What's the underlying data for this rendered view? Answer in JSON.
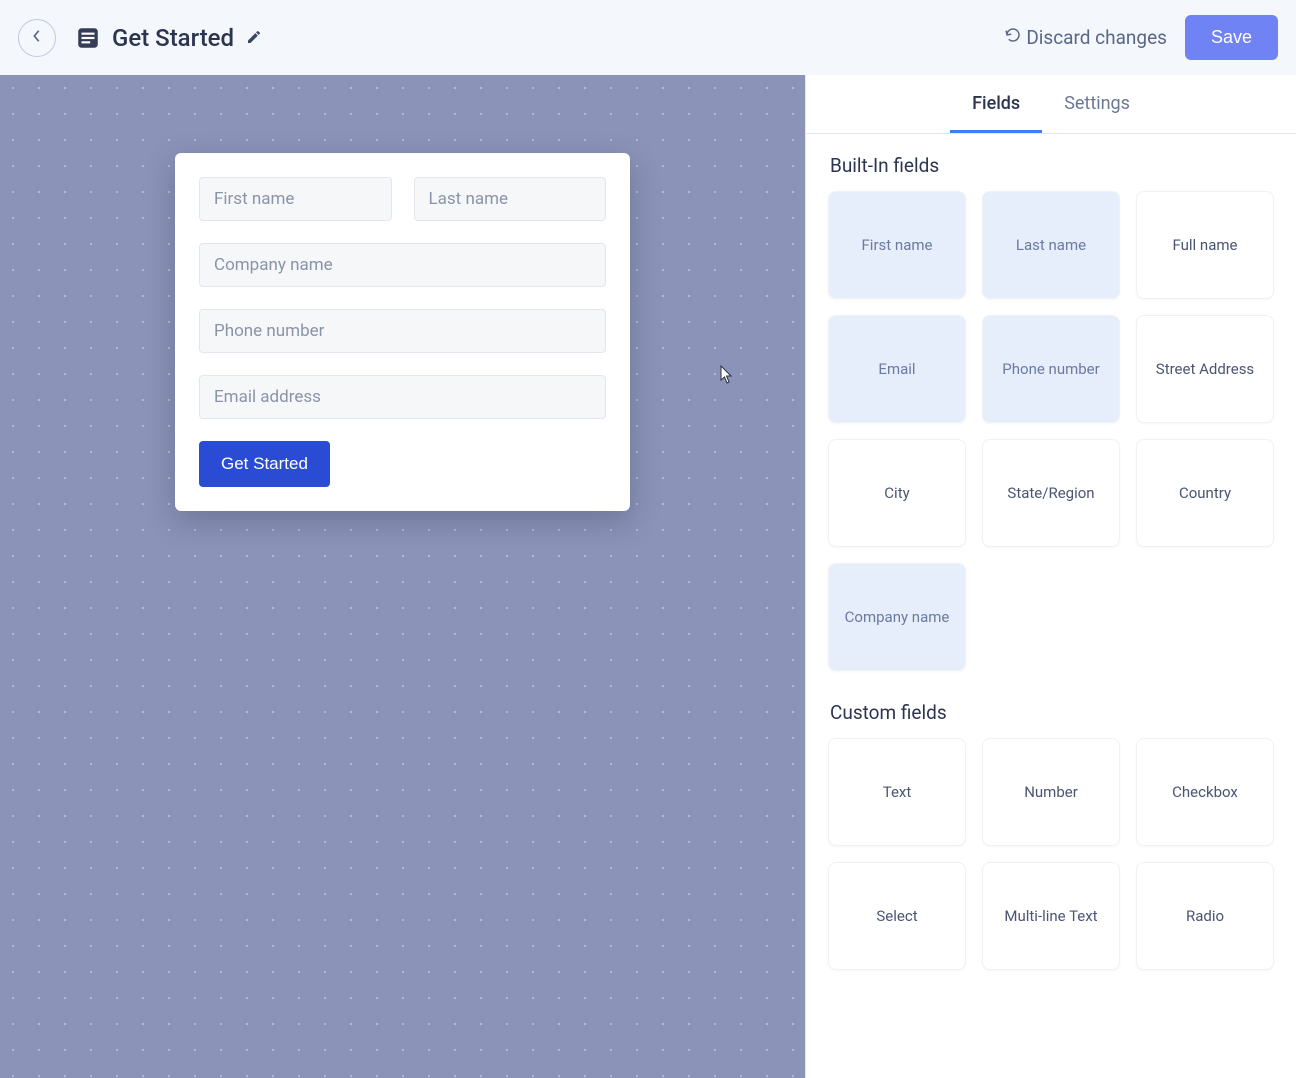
{
  "header": {
    "page_title": "Get Started",
    "discard_label": "Discard changes",
    "save_label": "Save"
  },
  "form": {
    "fields": [
      {
        "placeholder": "First name"
      },
      {
        "placeholder": "Last name"
      },
      {
        "placeholder": "Company name"
      },
      {
        "placeholder": "Phone number"
      },
      {
        "placeholder": "Email address"
      }
    ],
    "submit_label": "Get Started"
  },
  "panel": {
    "tabs": [
      {
        "label": "Fields",
        "active": true
      },
      {
        "label": "Settings",
        "active": false
      }
    ],
    "builtin_title": "Built-In fields",
    "builtin_fields": [
      {
        "label": "First name",
        "used": true
      },
      {
        "label": "Last name",
        "used": true
      },
      {
        "label": "Full name",
        "used": false
      },
      {
        "label": "Email",
        "used": true
      },
      {
        "label": "Phone number",
        "used": true
      },
      {
        "label": "Street Address",
        "used": false
      },
      {
        "label": "City",
        "used": false
      },
      {
        "label": "State/Region",
        "used": false
      },
      {
        "label": "Country",
        "used": false
      },
      {
        "label": "Company name",
        "used": true
      }
    ],
    "custom_title": "Custom fields",
    "custom_fields": [
      {
        "label": "Text"
      },
      {
        "label": "Number"
      },
      {
        "label": "Checkbox"
      },
      {
        "label": "Select"
      },
      {
        "label": "Multi-line Text"
      },
      {
        "label": "Radio"
      }
    ]
  }
}
